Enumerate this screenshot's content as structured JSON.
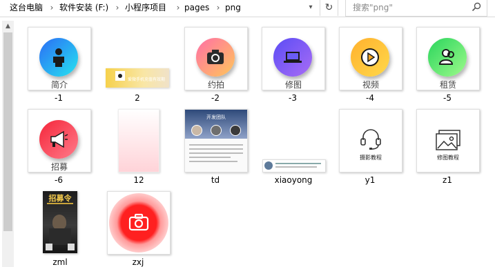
{
  "address_bar": {
    "crumbs": [
      "这台电脑",
      "软件安装 (F:)",
      "小程序项目",
      "pages",
      "png"
    ]
  },
  "search": {
    "placeholder": "搜索\"png\""
  },
  "files": [
    {
      "name": "-1",
      "caption": "简介",
      "icon": "person-icon",
      "color_from": "#2b6df5",
      "color_to": "#26e3f0"
    },
    {
      "name": "2",
      "banner_text": "爱微手机充值有效期"
    },
    {
      "name": "-2",
      "caption": "约拍",
      "icon": "camera-icon",
      "color_from": "#ff6fa6",
      "color_to": "#ffc65a"
    },
    {
      "name": "-3",
      "caption": "修图",
      "icon": "laptop-icon",
      "color_from": "#5b4df5",
      "color_to": "#a86cf5"
    },
    {
      "name": "-4",
      "caption": "视频",
      "icon": "play-icon",
      "color_from": "#ffb12e",
      "color_to": "#ffd84a"
    },
    {
      "name": "-5",
      "caption": "租赁",
      "icon": "users-icon",
      "color_from": "#2ad55d",
      "color_to": "#9dfa8a"
    },
    {
      "name": "-6",
      "caption": "招募",
      "icon": "megaphone-icon",
      "color_from": "#f5263a",
      "color_to": "#ff7b8a"
    },
    {
      "name": "12"
    },
    {
      "name": "td",
      "heading": "开发团队"
    },
    {
      "name": "xiaoyong"
    },
    {
      "name": "y1",
      "caption": "摄影教程",
      "icon": "headset-icon"
    },
    {
      "name": "z1",
      "caption": "修图教程",
      "icon": "photos-icon"
    },
    {
      "name": "zml",
      "heading": "招募令"
    },
    {
      "name": "zxj",
      "icon": "camera-icon"
    }
  ]
}
